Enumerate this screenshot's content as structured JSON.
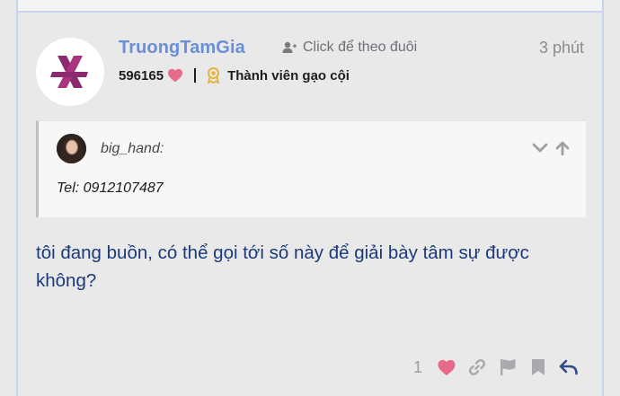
{
  "post": {
    "author": {
      "username": "TruongTamGia",
      "likes_received": "596165",
      "user_title": "Thành viên gạo cội"
    },
    "follow_label": "Click để theo đuôi",
    "time": "3 phút",
    "quote": {
      "username": "big_hand:",
      "text": "Tel: 0912107487"
    },
    "body": "tôi đang buồn, có thể gọi tới số này để giải bày tâm sự được không?",
    "actions": {
      "like_count": "1"
    }
  },
  "colors": {
    "username": "#6a8fd6",
    "heart": "#e66b8a",
    "body_text": "#1a3a7a",
    "logo": "#8b2a6e",
    "badge": "#e3b341"
  },
  "icons": [
    "user-plus-icon",
    "heart-icon",
    "award-icon",
    "chevron-down-icon",
    "arrow-up-icon",
    "link-icon",
    "flag-icon",
    "bookmark-icon",
    "reply-icon"
  ]
}
